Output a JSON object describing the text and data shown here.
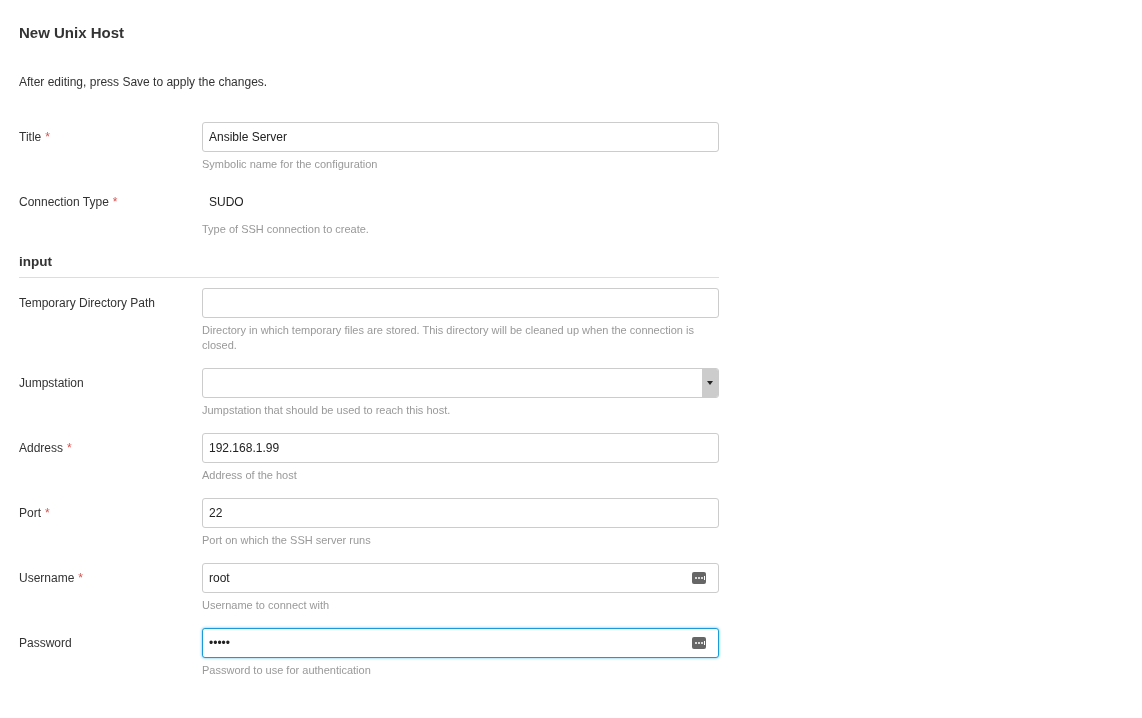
{
  "page": {
    "title": "New Unix Host",
    "description": "After editing, press Save to apply the changes."
  },
  "fields": [
    {
      "kind": "text",
      "label": "Title",
      "required_mark": "*",
      "value": "Ansible Server",
      "help": "Symbolic name for the configuration",
      "focused": false
    },
    {
      "kind": "static",
      "label": "Connection Type",
      "required_mark": "*",
      "value": "SUDO",
      "help": "Type of SSH connection to create."
    },
    {
      "kind": "section",
      "label": "input"
    },
    {
      "kind": "text",
      "label": "Temporary Directory Path",
      "help": "Directory in which temporary files are stored. This directory will be cleaned up when the connection is closed.",
      "focused": false
    },
    {
      "kind": "select",
      "label": "Jumpstation",
      "help": "Jumpstation that should be used to reach this host.",
      "focused": false
    },
    {
      "kind": "text",
      "label": "Address",
      "required_mark": "*",
      "value": "192.168.1.99",
      "help": "Address of the host",
      "focused": false
    },
    {
      "kind": "text",
      "label": "Port",
      "required_mark": "*",
      "value": "22",
      "help": "Port on which the SSH server runs",
      "focused": false
    },
    {
      "kind": "credential",
      "label": "Username",
      "required_mark": "*",
      "value": "root",
      "help": "Username to connect with",
      "focused": false
    },
    {
      "kind": "credential",
      "label": "Password",
      "value": "•••••",
      "help": "Password to use for authentication",
      "focused": true
    }
  ]
}
